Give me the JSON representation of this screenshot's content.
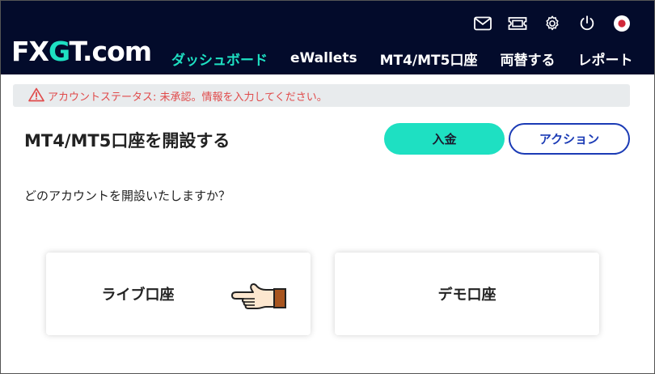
{
  "brand": {
    "logo_fx": "FX",
    "logo_g": "G",
    "logo_t": "T",
    "logo_com": ".com",
    "accent_color": "#1ee0c2",
    "header_color": "#030b2b"
  },
  "header_icons": [
    "mail-icon",
    "ticket-icon",
    "gear-icon",
    "power-icon",
    "japan-flag-icon"
  ],
  "nav": {
    "items": [
      {
        "label": "ダッシュボード",
        "active": true
      },
      {
        "label": "eWallets",
        "active": false
      },
      {
        "label": "MT4/MT5口座",
        "active": false
      },
      {
        "label": "両替する",
        "active": false
      },
      {
        "label": "レポート",
        "active": false
      }
    ]
  },
  "alert": {
    "text": "アカウントステータス: 未承認。情報を入力してください。",
    "color": "#e04a4a"
  },
  "page": {
    "title": "MT4/MT5口座を開設する",
    "deposit_label": "入金",
    "action_label": "アクション",
    "question": "どのアカウントを開設いたしますか？"
  },
  "cards": {
    "live_label": "ライブ口座",
    "demo_label": "デモ口座"
  }
}
